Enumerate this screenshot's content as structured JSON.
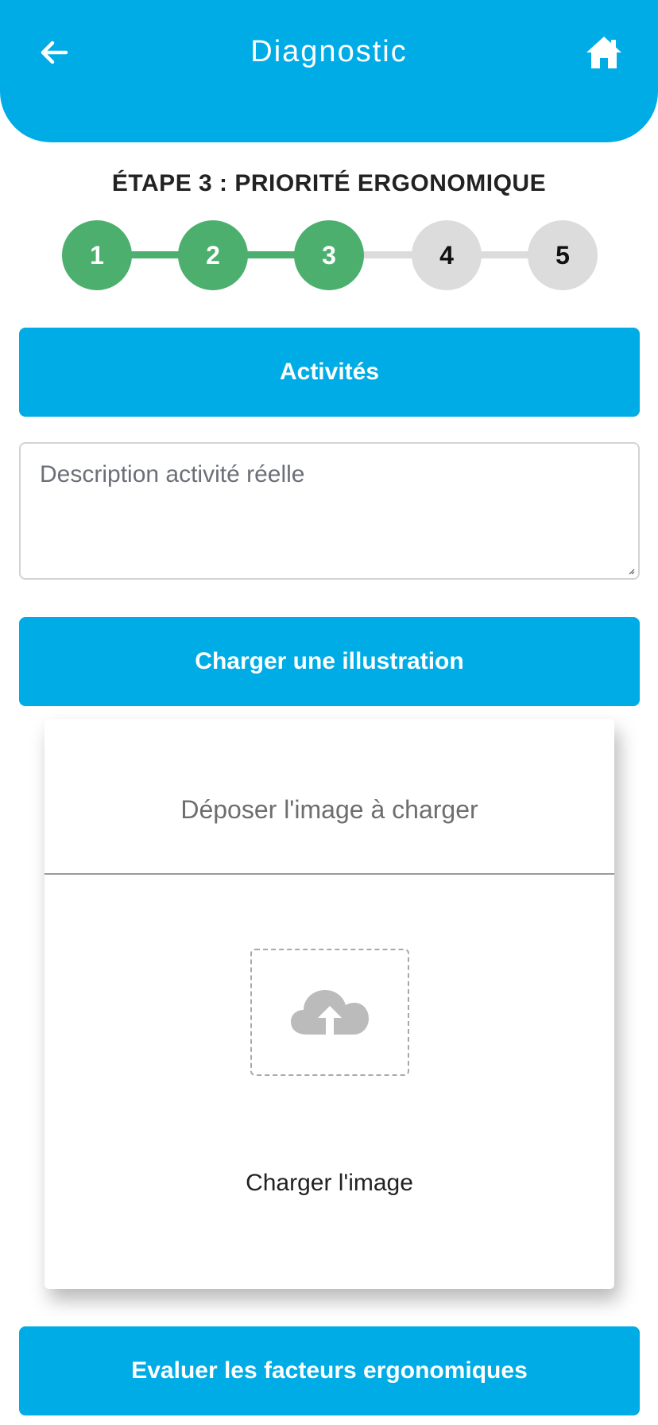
{
  "header": {
    "title": "Diagnostic",
    "back_icon": "arrow-left-icon",
    "home_icon": "home-icon",
    "color": "#00ace5"
  },
  "step_title": "ÉTAPE 3 : PRIORITÉ ERGONOMIQUE",
  "stepper": {
    "steps": [
      "1",
      "2",
      "3",
      "4",
      "5"
    ],
    "current_step": 3,
    "done_color": "#4caf6e",
    "todo_color": "#dcdcdc"
  },
  "activities_button": "Activités",
  "description_field": {
    "placeholder": "Description activité réelle",
    "value": ""
  },
  "upload_button": "Charger une illustration",
  "upload_card": {
    "drop_text": "Déposer l'image à charger",
    "upload_icon": "cloud-upload-icon",
    "load_label": "Charger l'image"
  },
  "evaluate_button": "Evaluer les facteurs ergonomiques"
}
